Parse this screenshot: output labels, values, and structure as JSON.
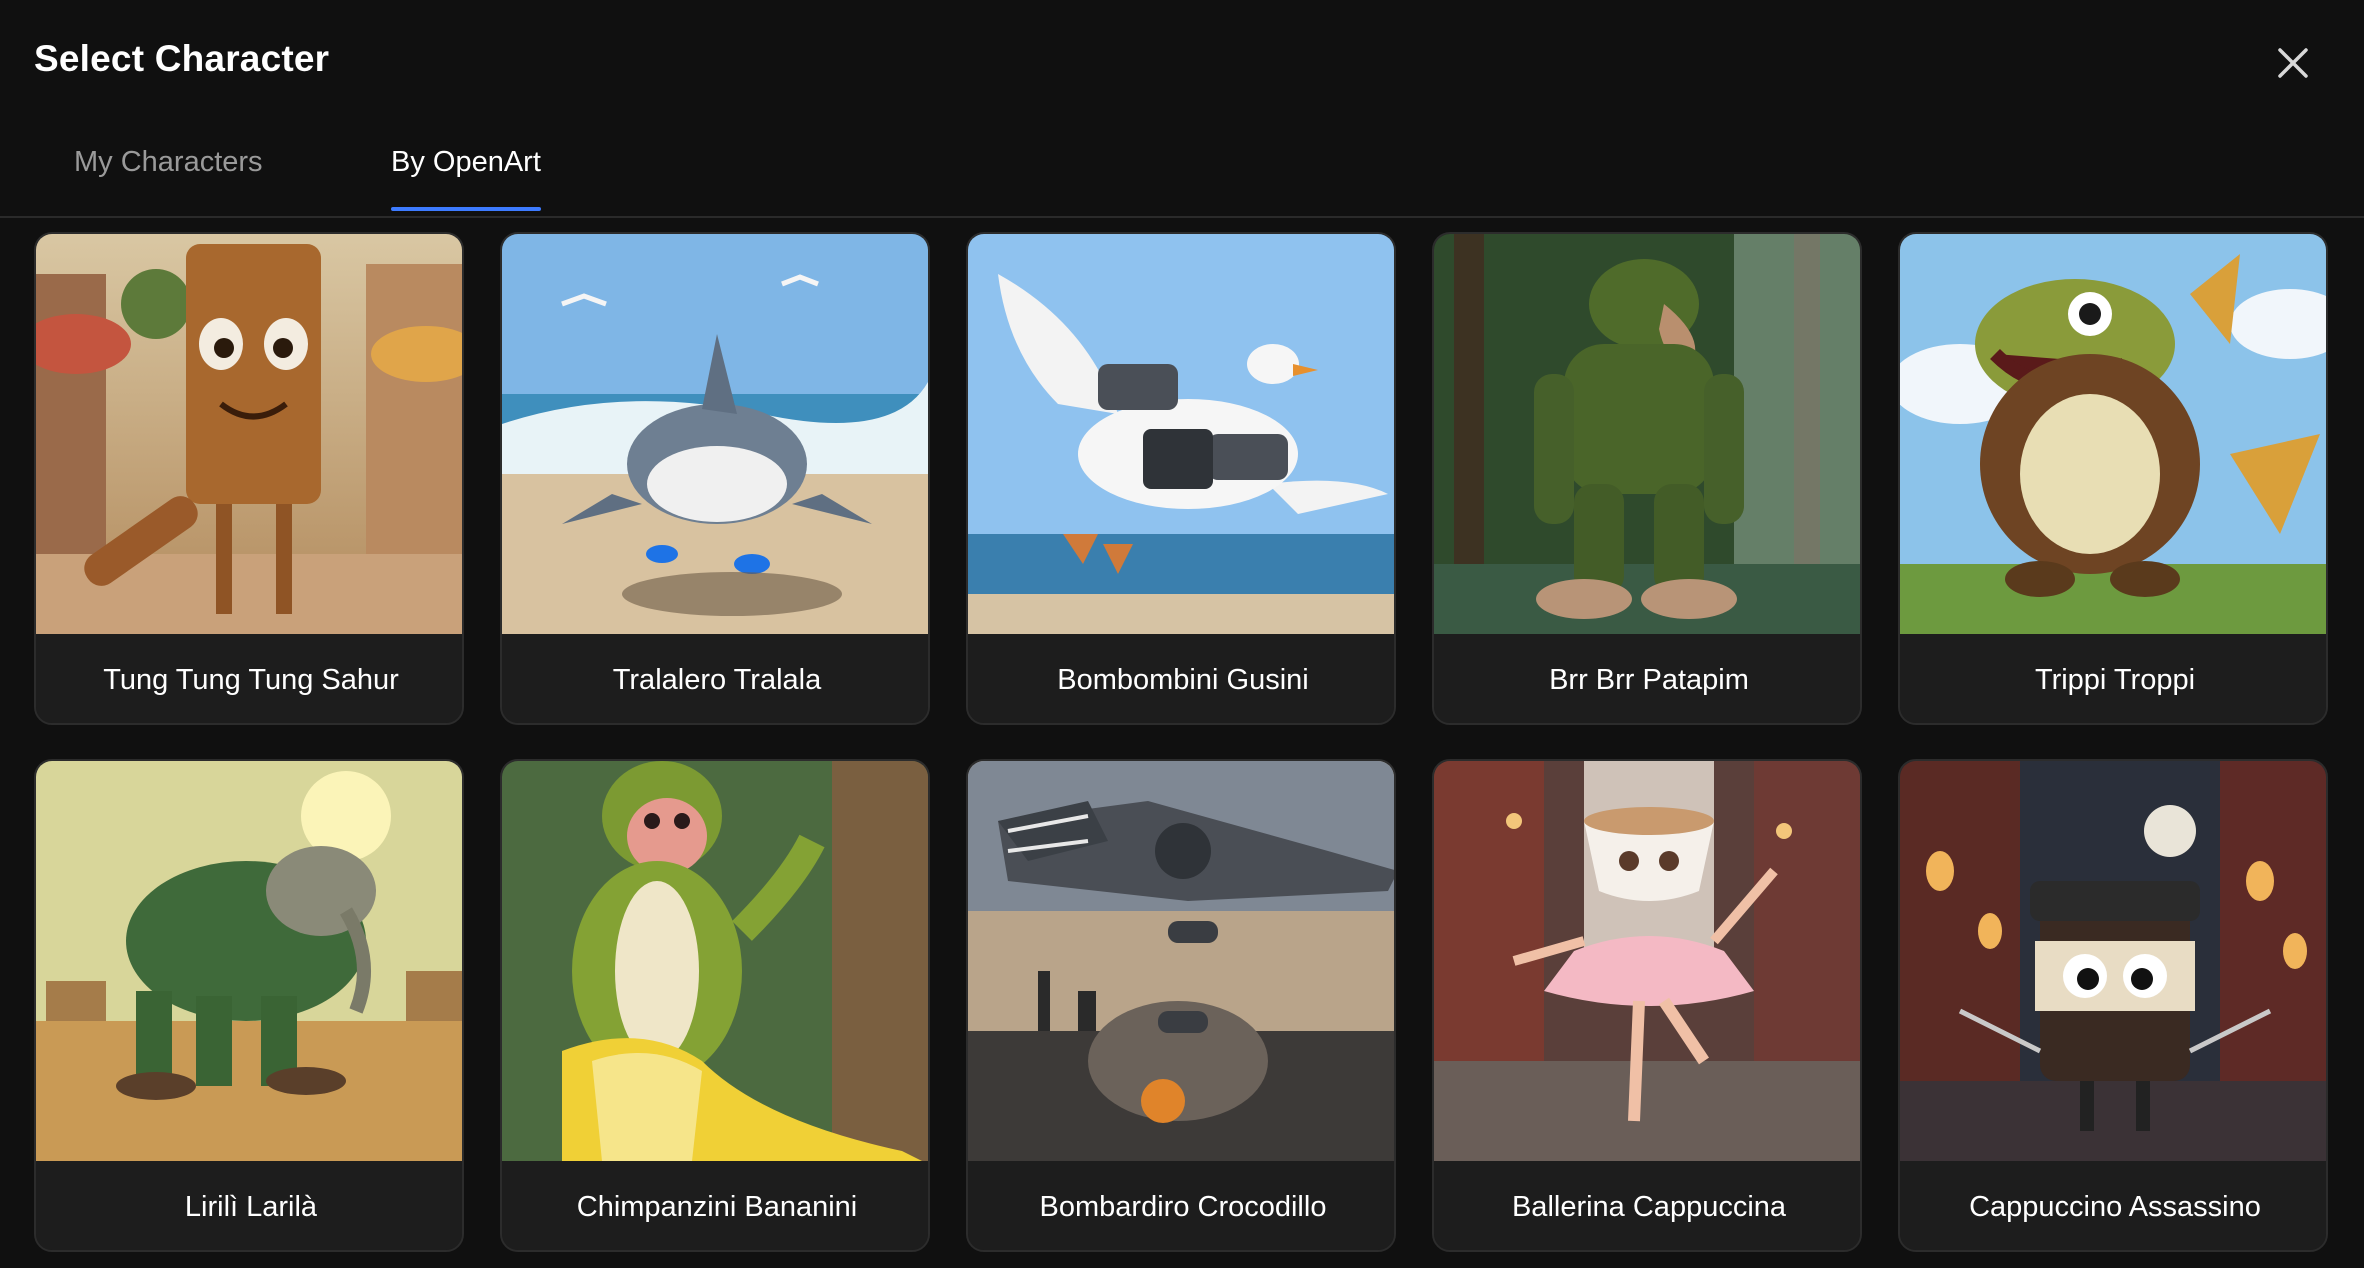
{
  "dialog": {
    "title": "Select Character",
    "close_icon": "close-icon"
  },
  "tabs": [
    {
      "label": "My Characters",
      "active": false
    },
    {
      "label": "By OpenArt",
      "active": true
    }
  ],
  "colors": {
    "background": "#101010",
    "accent": "#3d7bff",
    "card": "#1d1d1d"
  },
  "characters": [
    {
      "name": "Tung Tung Tung Sahur"
    },
    {
      "name": "Tralalero Tralala"
    },
    {
      "name": "Bombombini Gusini"
    },
    {
      "name": "Brr Brr Patapim"
    },
    {
      "name": "Trippi Troppi"
    },
    {
      "name": "Lirilì Larilà"
    },
    {
      "name": "Chimpanzini Bananini"
    },
    {
      "name": "Bombardiro Crocodillo"
    },
    {
      "name": "Ballerina Cappuccina"
    },
    {
      "name": "Cappuccino Assassino"
    }
  ]
}
